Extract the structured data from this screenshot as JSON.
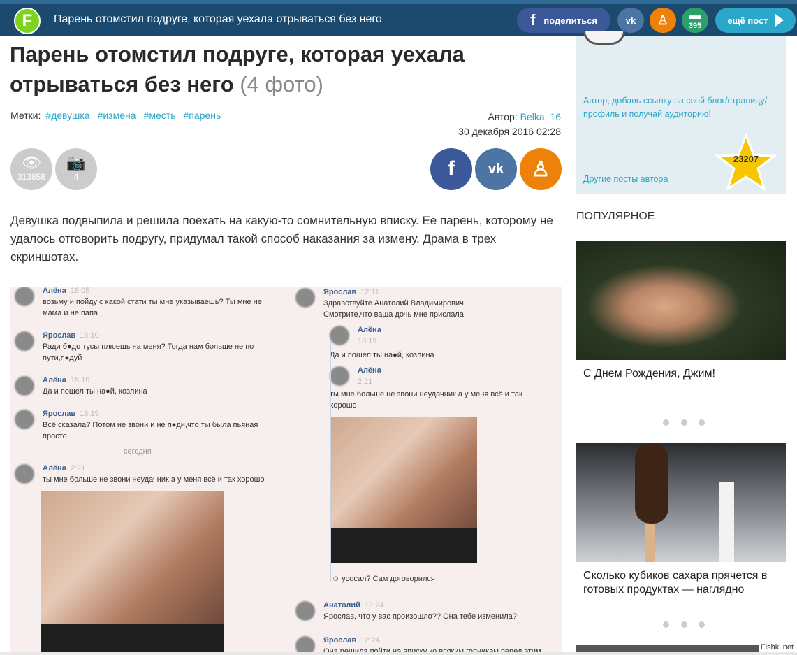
{
  "topbar": {
    "logo": "F",
    "title": "Парень отомстил подруге, которая уехала отрываться без него",
    "share_fb": "поделиться",
    "vk": "vk",
    "ok": "ok",
    "comments": "395",
    "next_post": "ещё пост"
  },
  "article": {
    "title": "Парень отомстил подруге, которая уехала отрываться без него",
    "photo_count": "(4 фото)",
    "tags_label": "Метки:",
    "tags": [
      "#девушка",
      "#измена",
      "#месть",
      "#парень"
    ],
    "author_label": "Автор:",
    "author": "Belka_16",
    "date": "30 декабря 2016 02:28",
    "views": "313858",
    "photos": "4",
    "lead": "Девушка подвыпила и решила поехать на какую-то сомнительную вписку. Ее парень, которому не удалось отговорить подругу, придумал такой способ наказания за измену. Драма в трех скриншотах."
  },
  "chat_left": [
    {
      "name": "Алёна",
      "time": "18:05",
      "text": "возьму и пойду с какой стати ты мне указываешь? Ты мне не мама и не папа"
    },
    {
      "name": "Ярослав",
      "time": "18:10",
      "text": "Ради б●до тусы плюешь на меня? Тогда нам больше не по пути,п●дуй"
    },
    {
      "name": "Алёна",
      "time": "18:19",
      "text": "Да и пошел ты на●й, козлина"
    },
    {
      "name": "Ярослав",
      "time": "18:19",
      "text": "Всё сказала? Потом не звони и не п●ди,что ты была пьяная просто"
    },
    {
      "name": "Алёна",
      "time": "2:21",
      "text": "ты мне больше не звони неудачник а у меня всё и так хорошо"
    }
  ],
  "chat_today": "сегодня",
  "chat_right": [
    {
      "name": "Ярослав",
      "time": "12:11",
      "text": "Здравствуйте Анатолий Владимирович Смотрите,что ваша дочь мне прислала"
    },
    {
      "name": "Алёна",
      "time": "18:19",
      "text": "Да и пошел ты на●й, козлина"
    },
    {
      "name": "Алёна",
      "time": "2:21",
      "text": "ты мне больше не звони неудачник а у меня всё и так хорошо"
    },
    {
      "name": "",
      "time": "",
      "text": "☺ усосал? Сам договорился"
    },
    {
      "name": "Анатолий",
      "time": "12:24",
      "text": "Ярослав, что у вас произошло?? Она тебе изменила?"
    },
    {
      "name": "Ярослав",
      "time": "12:24",
      "text": "Она решила пойти на вписку ко всяким гопникам перед этим"
    }
  ],
  "sidebar": {
    "author_hint": "Автор, добавь ссылку на свой блог/страницу/профиль и получай аудиторию!",
    "author_rating": "23207",
    "author_more": "Другие посты автора",
    "popular_heading": "ПОПУЛЯРНОЕ",
    "cards": [
      {
        "title": "С Днем Рождения, Джим!"
      },
      {
        "title": "Сколько кубиков сахара прячется в готовых продуктах — наглядно"
      }
    ]
  },
  "watermark": "Fishki.net",
  "colors": {
    "topbar": "#1c4a6e",
    "accent": "#2ba7c9",
    "facebook": "#3b5998",
    "vk": "#4c75a3",
    "ok": "#ee8208",
    "logo": "#7ed321"
  }
}
